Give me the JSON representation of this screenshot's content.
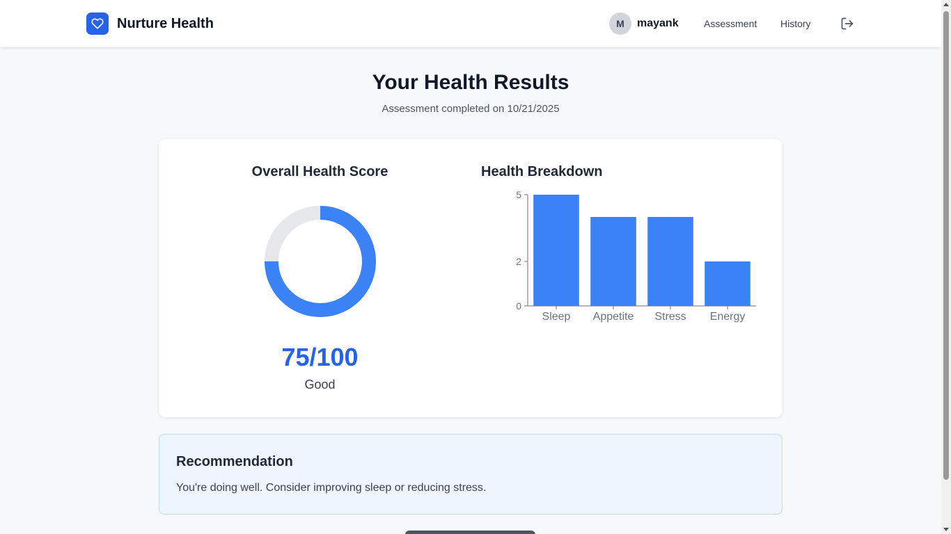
{
  "header": {
    "brand_name": "Nurture Health",
    "avatar_initial": "M",
    "username": "mayank",
    "nav": {
      "assessment": "Assessment",
      "history": "History"
    }
  },
  "page": {
    "title": "Your Health Results",
    "subtitle": "Assessment completed on 10/21/2025"
  },
  "score": {
    "heading": "Overall Health Score",
    "value": 75,
    "max": 100,
    "display": "75/100",
    "label": "Good"
  },
  "breakdown": {
    "heading": "Health Breakdown"
  },
  "chart_data": {
    "type": "bar",
    "categories": [
      "Sleep",
      "Appetite",
      "Stress",
      "Energy"
    ],
    "values": [
      5,
      4,
      4,
      2
    ],
    "y_ticks": [
      0,
      2,
      5
    ],
    "ylim": [
      0,
      5
    ],
    "title": "",
    "xlabel": "",
    "ylabel": "",
    "bar_color": "#3b82f6"
  },
  "recommendation": {
    "title": "Recommendation",
    "text": "You're doing well. Consider improving sleep or reducing stress."
  },
  "colors": {
    "brand": "#2563eb",
    "score_arc": "#3b82f6",
    "score_track": "#e5e7eb",
    "recommendation_bg": "#eef5fe"
  },
  "icons": {
    "brand": "heart-icon",
    "logout": "logout-icon"
  }
}
